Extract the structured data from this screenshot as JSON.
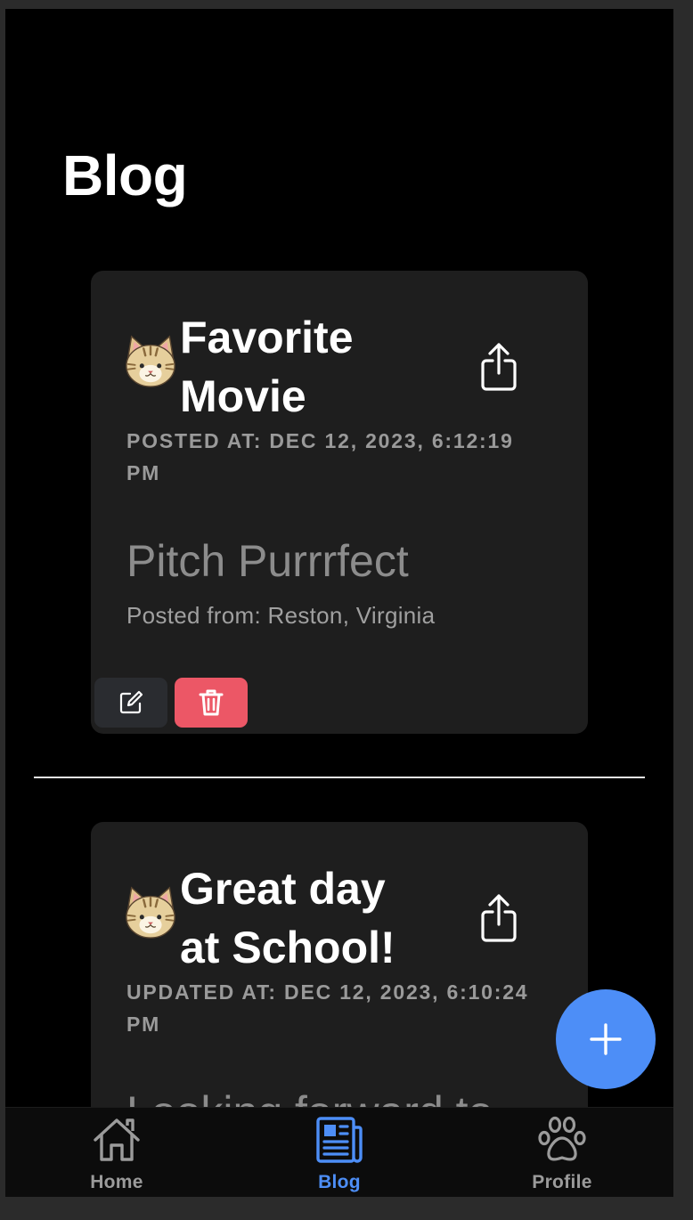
{
  "header": {
    "title": "Blog"
  },
  "posts": [
    {
      "title_line1": "Favorite",
      "title_line2": "Movie",
      "timestamp_line1": "POSTED AT: DEC 12, 2023, 6:12:19",
      "timestamp_line2": "PM",
      "body": "Pitch Purrrfect",
      "location": "Posted from: Reston, Virginia",
      "avatar_icon": "cat-face-icon",
      "share_icon": "share-icon",
      "edit_icon": "edit-icon",
      "delete_icon": "trash-icon"
    },
    {
      "title_line1": "Great day",
      "title_line2": "at School!",
      "timestamp_line1": "UPDATED AT: DEC 12, 2023, 6:10:24",
      "timestamp_line2": "PM",
      "body": "Looking forward to",
      "avatar_icon": "cat-face-icon",
      "share_icon": "share-icon"
    }
  ],
  "fab": {
    "icon": "plus-icon"
  },
  "tabbar": {
    "tabs": [
      {
        "label": "Home",
        "icon": "home-icon",
        "active": false
      },
      {
        "label": "Blog",
        "icon": "newspaper-icon",
        "active": true
      },
      {
        "label": "Profile",
        "icon": "paw-icon",
        "active": false
      }
    ]
  },
  "colors": {
    "accent": "#4d8ef7",
    "delete": "#ec5766",
    "card_bg": "#1e1e1e",
    "background": "#000000"
  }
}
